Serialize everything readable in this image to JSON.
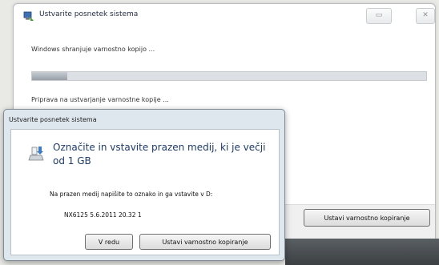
{
  "main_window": {
    "title": "Ustvarite posnetek sistema",
    "minimize_glyph": "▭",
    "close_glyph": "✕",
    "status": "Windows shranjuje varnostno kopijo ...",
    "progress": 0.09,
    "prep_text": "Priprava na ustvarjanje varnostne kopije ...",
    "backup_button": "Ustavi varnostno kopiranje"
  },
  "dialog": {
    "title": "Ustvarite posnetek sistema",
    "heading": "Označite in vstavite prazen medij, ki je večji od 1 GB",
    "instruction": "Na prazen medij napišite to oznako in ga vstavite v D:",
    "label": "NX6125 5.6.2011 20.32  1",
    "ok_button": "V redu",
    "backup_button": "Ustavi varnostno kopiranje"
  },
  "icons": {
    "title_icon": "system-image-icon",
    "media_icon": "disc-media-icon"
  }
}
